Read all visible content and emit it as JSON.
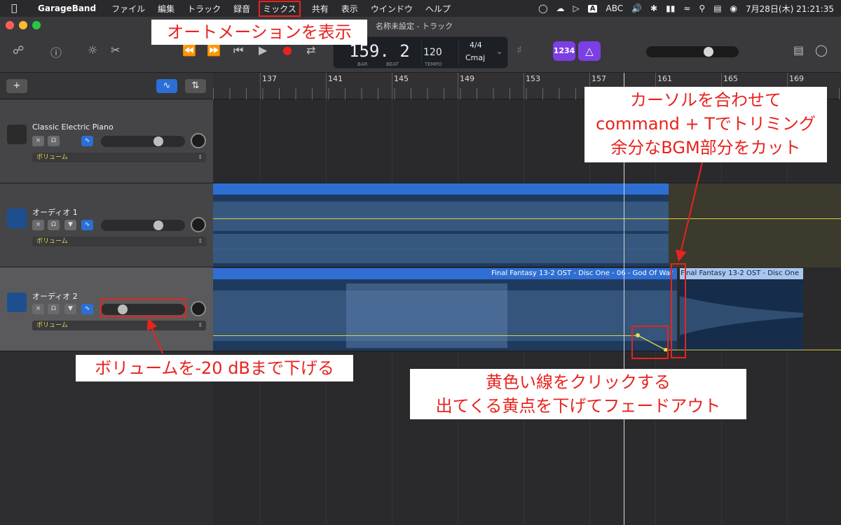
{
  "menubar": {
    "app": "GarageBand",
    "menus": [
      "ファイル",
      "編集",
      "トラック",
      "録音",
      "ミックス",
      "共有",
      "表示",
      "ウインドウ",
      "ヘルプ"
    ],
    "input_source": "ABC",
    "clock": "7月28日(木)  21:21:35"
  },
  "window": {
    "title": "名称未設定 - トラック"
  },
  "lcd": {
    "bar": "159. 2",
    "bar_label": "BAR",
    "beat_label": "BEAT",
    "tempo": "120",
    "tempo_label": "TEMPO",
    "time_sig": "4/4",
    "key": "Cmaj"
  },
  "toolbar": {
    "count_in": "1234"
  },
  "ruler": {
    "bars": [
      "137",
      "141",
      "145",
      "149",
      "153",
      "157",
      "161",
      "165",
      "169"
    ]
  },
  "tracks": [
    {
      "name": "Classic Electric Piano",
      "automation": "ボリューム",
      "volume": 0.72
    },
    {
      "name": "オーディオ 1",
      "automation": "ボリューム",
      "volume": 0.72
    },
    {
      "name": "オーディオ 2",
      "automation": "ボリューム",
      "volume": 0.22
    }
  ],
  "regions": {
    "audio2_a": "Final Fantasy 13-2 OST - Disc One - 06 - God Of War",
    "audio2_b": "Final Fantasy 13-2 OST - Disc One"
  },
  "annotations": {
    "automation": "オートメーションを表示",
    "cut_1": "カーソルを合わせて",
    "cut_2": "command + Tでトリミング",
    "cut_3": "余分なBGM部分をカット",
    "volume": "ボリュームを-20 dBまで下げる",
    "fade_1": "黄色い線をクリックする",
    "fade_2": "出てくる黄点を下げてフェードアウト"
  },
  "colors": {
    "annotation_red": "#e8231f",
    "region_blue": "#2f6fd3",
    "automation_yellow": "#d9d24a"
  }
}
